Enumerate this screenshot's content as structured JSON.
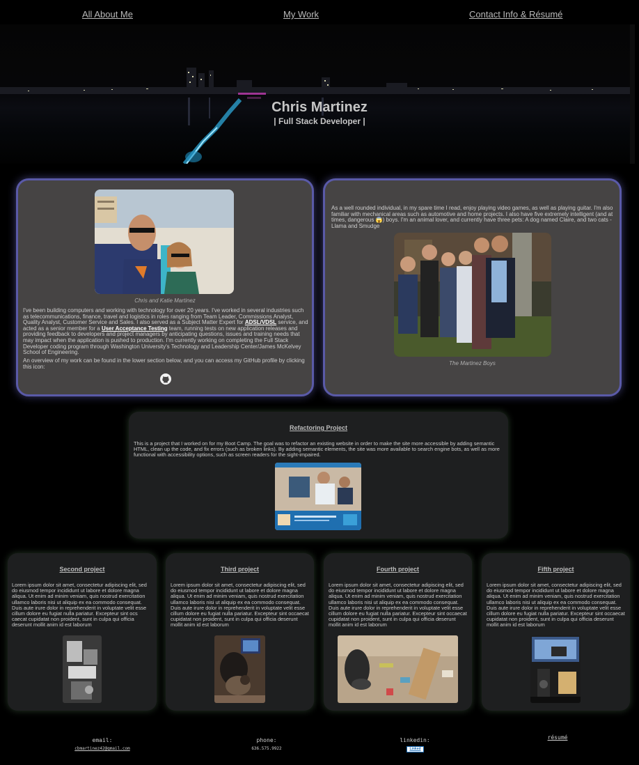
{
  "nav": {
    "about": "All About Me",
    "work": "My Work",
    "contact": "Contact Info & Résumé"
  },
  "hero": {
    "name": "Chris Martinez",
    "subtitle": "| Full Stack Developer |"
  },
  "about": {
    "photo_caption": "Chris and Katie Martinez",
    "bio_part1": "I've been building computers and working with technology for over 20 years. I've worked in several industries such as telecommunications, finance, travel and logistics in roles ranging from Team Leader, Commissions Analyst, Quality Analyst, Customer Service and Sales. I also served as a Subject Matter Expert for ",
    "bio_link1": "ADSL/VDSL",
    "bio_part2": " service, and acted as a senior member for a ",
    "bio_link2": "User Acceptance Testing",
    "bio_part3": " team, running tests on new application releases and providing feedback to developers and project managers by anticipating questions, issues and training needs that may impact when the application is pushed to production. I'm currently working on completing the Full Stack Developer coding program through Washington University's Technology and Leadership Center/James McKelvey School of Engineering.",
    "github_text": "An overview of my work can be found in the lower section below, and you can access my GitHub profile by clicking this icon:",
    "hobbies_part1": "As a well rounded individual, in my spare time I read, enjoy playing video games, as well as playing guitar. I'm also familiar with mechanical areas such as automotive and home projects. I also have five extremely intelligent (and at times, dangerous ",
    "hobbies_emoji": "😱",
    "hobbies_part2": ") boys. I'm an animal lover, and currently have three pets: A dog named Claire, and two cats - Llama and Smudge",
    "family_caption": "The Martinez Boys"
  },
  "featured": {
    "title": "Refactoring Project",
    "text": "This is a project that I worked on for my Boot Camp. The goal was to refactor an existing website in order to make the site more accessible by adding semantic HTML, clean up the code, and fix errors (such as broken links). By adding semantic elements, the site was more available to search engine bots, as well as more functional with accessibility options, such as screen readers for the sight-impaired."
  },
  "projects": [
    {
      "title": "Second project",
      "text": "Lorem ipsum dolor sit amet, consectetur adipiscing elit, sed do eiusmod tempor incididunt ut labore et dolore magna aliqua. Ut enim ad minim veniam, quis nostrud exercitation ullamco laboris nisi ut aliquip ex ea commodo consequat. Duis aute irure dolor in reprehenderit in voluptate velit esse cillum dolore eu fugiat nulla pariatur. Excepteur sint ocs caecat cupidatat non proident, sunt in culpa qui officia deserunt mollit anim id est laborum"
    },
    {
      "title": "Third project",
      "text": "Lorem ipsum dolor sit amet, consectetur adipiscing elit, sed do eiusmod tempor incididunt ut labore et dolore magna aliqua. Ut enim ad minim veniam, quis nostrud exercitation ullamco laboris nisi ut aliquip ex ea commodo consequat. Duis aute irure dolor in reprehenderit in voluptate velit esse cillum dolore eu fugiat nulla pariatur. Excepteur sint occaecat cupidatat non proident, sunt in culpa qui officia deserunt mollit anim id est laborum"
    },
    {
      "title": "Fourth project",
      "text": "Lorem ipsum dolor sit amet, consectetur adipiscing elit, sed do eiusmod tempor incididunt ut labore et dolore magna aliqua. Ut enim ad minim veniam, quis nostrud exercitation ullamco laboris nisi ut aliquip ex ea commodo consequat. Duis aute irure dolor in reprehenderit in voluptate velit esse cillum dolore eu fugiat nulla pariatur. Excepteur sint occaecat cupidatat non proident, sunt in culpa qui officia deserunt mollit anim id est laborum"
    },
    {
      "title": "Fifth project",
      "text": "Lorem ipsum dolor sit amet, consectetur adipiscing elit, sed do eiusmod tempor incididunt ut labore et dolore magna aliqua. Ut enim ad minim veniam, quis nostrud exercitation ullamco laboris nisi ut aliquip ex ea commodo consequat. Duis aute irure dolor in reprehenderit in voluptate velit esse cillum dolore eu fugiat nulla pariatur. Excepteur sint occaecat cupidatat non proident, sunt in culpa qui officia deserunt mollit anim id est laborum"
    }
  ],
  "footer": {
    "email_label": "email:",
    "email_value": "cbmartinez42@gmail.com",
    "phone_label": "phone:",
    "phone_value": "636.575.9922",
    "linkedin_label": "linkedin:",
    "linkedin_logo": "Linked",
    "resume_label": "résumé"
  },
  "icons": {
    "github": "github-icon",
    "linkedin": "linkedin-icon"
  },
  "colors": {
    "about_card_bg": "#464444",
    "about_card_border": "#5a5aa8",
    "project_card_bg": "#1e1f20"
  }
}
